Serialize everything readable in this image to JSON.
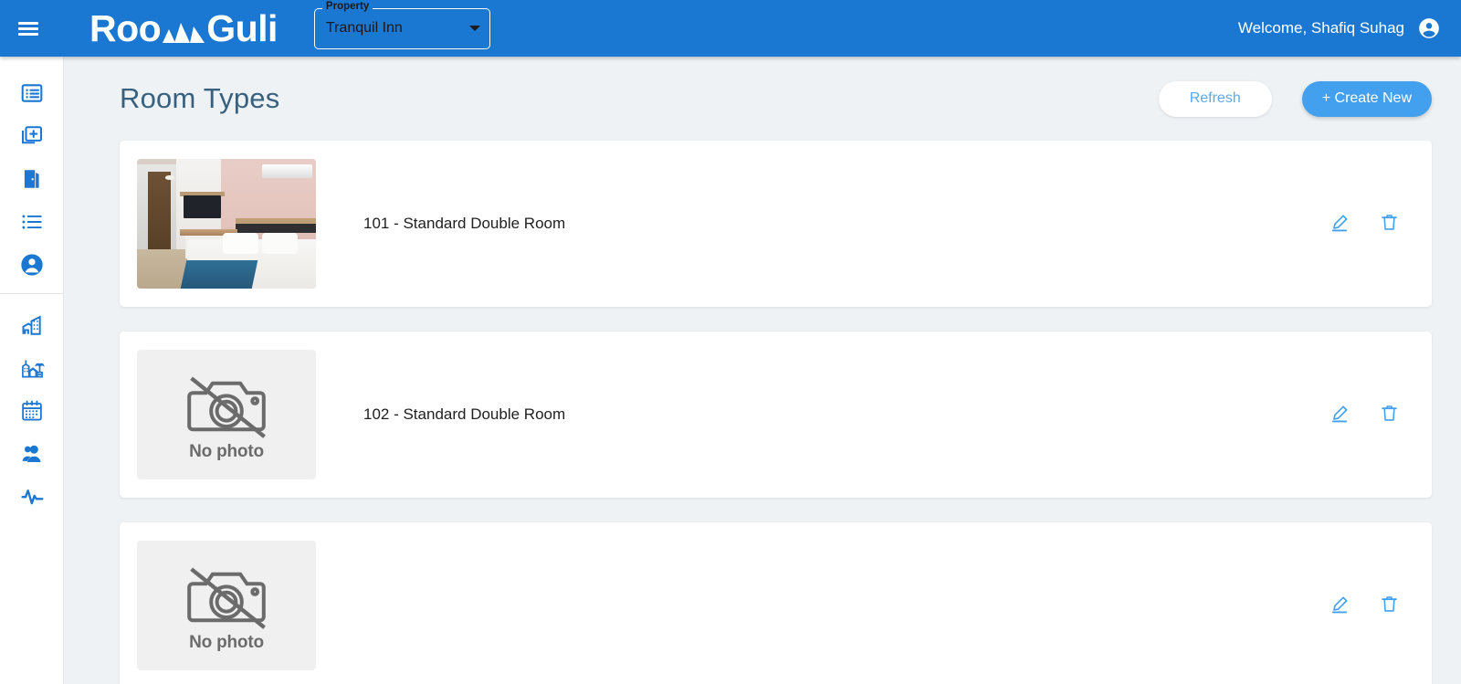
{
  "topbar": {
    "menu_icon": "hamburger-menu-icon",
    "brand_left": "Roo",
    "brand_mountain_icon": "mountain-icon",
    "brand_right": "Guli",
    "property_label": "Property",
    "property_value": "Tranquil Inn",
    "property_options": [
      "Tranquil Inn"
    ],
    "dropdown_icon": "chevron-down-icon",
    "welcome_text": "Welcome, Shafiq Suhag",
    "account_icon": "account-circle-icon",
    "background_color": "#1a77d2"
  },
  "sidebar": {
    "groups": [
      {
        "items": [
          {
            "icon": "list-box-icon",
            "name": "sidebar-item-bookings-list"
          },
          {
            "icon": "add-box-icon",
            "name": "sidebar-item-new-booking"
          },
          {
            "icon": "door-icon",
            "name": "sidebar-item-rooms"
          },
          {
            "icon": "bullet-list-icon",
            "name": "sidebar-item-room-types"
          },
          {
            "icon": "person-circle-icon",
            "name": "sidebar-item-guests"
          }
        ]
      },
      {
        "items": [
          {
            "icon": "apartment-icon",
            "name": "sidebar-item-properties"
          },
          {
            "icon": "resort-village-icon",
            "name": "sidebar-item-resorts"
          },
          {
            "icon": "calendar-icon",
            "name": "sidebar-item-calendar"
          },
          {
            "icon": "support-agent-icon",
            "name": "sidebar-item-staff"
          },
          {
            "icon": "activity-pulse-icon",
            "name": "sidebar-item-activity"
          }
        ]
      }
    ]
  },
  "page": {
    "title": "Room Types",
    "refresh_label": "Refresh",
    "create_label": "+ Create New",
    "accent_color": "#42a0ef",
    "title_color": "#37617e",
    "background_color": "#eef2f5"
  },
  "rooms": [
    {
      "name": "101 - Standard Double Room",
      "has_photo": true,
      "photo_alt": "hotel-room-photo",
      "edit_icon": "edit-pencil-icon",
      "delete_icon": "trash-delete-icon"
    },
    {
      "name": "102 - Standard Double Room",
      "has_photo": false,
      "no_photo_label": "No photo",
      "no_photo_icon": "no-camera-icon",
      "edit_icon": "edit-pencil-icon",
      "delete_icon": "trash-delete-icon"
    },
    {
      "name": "",
      "has_photo": false,
      "no_photo_label": "No photo",
      "no_photo_icon": "no-camera-icon",
      "edit_icon": "edit-pencil-icon",
      "delete_icon": "trash-delete-icon"
    }
  ]
}
